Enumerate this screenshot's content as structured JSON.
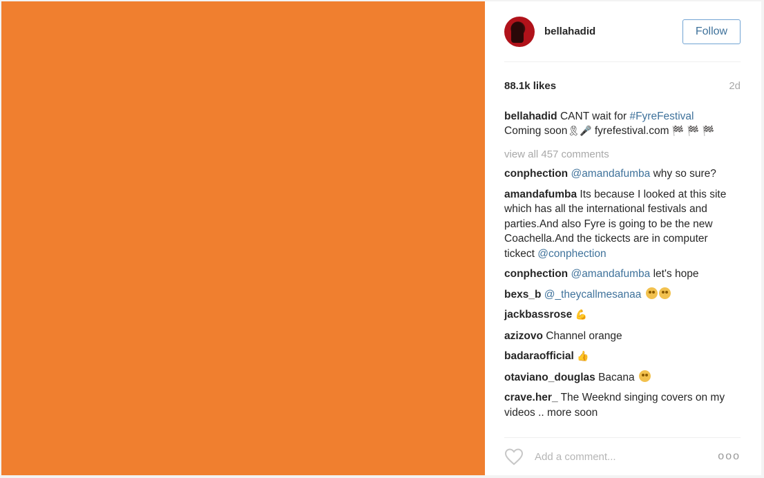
{
  "media": {
    "background_color": "#f07f2f"
  },
  "header": {
    "username": "bellahadid",
    "follow_label": "Follow"
  },
  "post": {
    "likes": "88.1k likes",
    "age": "2d",
    "caption": {
      "username": "bellahadid",
      "text_before_tag": " CANT wait for ",
      "hashtag": "#FyreFestival",
      "line2": "Coming soon",
      "emoji_ribbon": "🎗",
      "emoji_mic": "🎤",
      "site": " fyrefestival.com ",
      "emoji_flags": "🏁 🏁 🏁"
    },
    "view_all": "view all 457 comments"
  },
  "comments": [
    {
      "user": "conphection",
      "mention": "@amandafumba",
      "text": " why so sure?"
    },
    {
      "user": "amandafumba",
      "text": " Its because I looked at this site which has all the international festivals and parties.And also Fyre is going to be the new Coachella.And the tickects are in computer tickect ",
      "mention_end": "@conphection"
    },
    {
      "user": "conphection",
      "mention": "@amandafumba",
      "text": " let's hope"
    },
    {
      "user": "bexs_b",
      "mention": "@_theycallmesanaa",
      "text": ""
    },
    {
      "user": "jackbassrose",
      "text": "",
      "emoji": "💪"
    },
    {
      "user": "azizovo",
      "text": " Channel orange"
    },
    {
      "user": "badaraofficial",
      "text": "",
      "emoji": "👍"
    },
    {
      "user": "otaviano_douglas",
      "text": " Bacana"
    },
    {
      "user": "crave.her_",
      "text": " The Weeknd singing covers on my videos .. more soon"
    }
  ],
  "footer": {
    "comment_placeholder": "Add a comment...",
    "more_label": "ooo",
    "heart_icon": "heart-outline-icon"
  },
  "colors": {
    "link": "#3f729b",
    "follow_border": "#70a3d3",
    "muted": "#a8a8a8"
  }
}
